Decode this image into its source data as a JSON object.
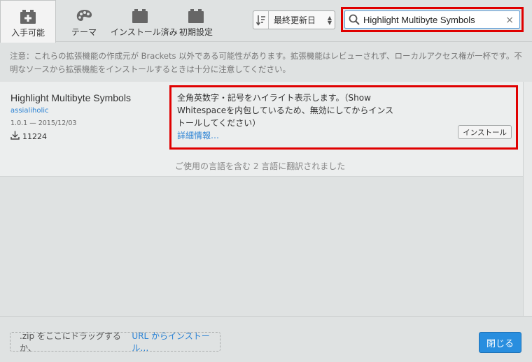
{
  "tabs": [
    {
      "label": "入手可能",
      "icon": "plus-box-icon",
      "active": true
    },
    {
      "label": "テーマ",
      "icon": "palette-icon",
      "active": false
    },
    {
      "label": "インストール済み",
      "icon": "installed-box-icon",
      "active": false
    },
    {
      "label": "初期設定",
      "icon": "default-box-icon",
      "active": false
    }
  ],
  "sort": {
    "label": "最終更新日"
  },
  "search": {
    "value": "Highlight Multibyte Symbols",
    "clear": "×"
  },
  "notice": "注意：これらの拡張機能の作成元が Brackets 以外である可能性があります。拡張機能はレビューされず、ローカルアクセス権が一杯です。不明なソースから拡張機能をインストールするときは十分に注意してください。",
  "extension": {
    "name": "Highlight Multibyte Symbols",
    "author": "assialiholic",
    "version": "1.0.1 — 2015/12/03",
    "downloads": "11224",
    "description": "全角英数字・記号をハイライト表示します。（Show Whitespaceを内包しているため、無効にしてからインストールしてください）",
    "more": "詳細情報…",
    "install": "インストール",
    "translated": "ご使用の言語を含む 2 言語に翻訳されました"
  },
  "footer": {
    "drop_text": ".zip をここにドラッグするか、",
    "url_link": "URL からインストール…",
    "close": "閉じる"
  },
  "colors": {
    "accent": "#288edf",
    "link": "#2a82d4",
    "highlight": "#e00000"
  }
}
